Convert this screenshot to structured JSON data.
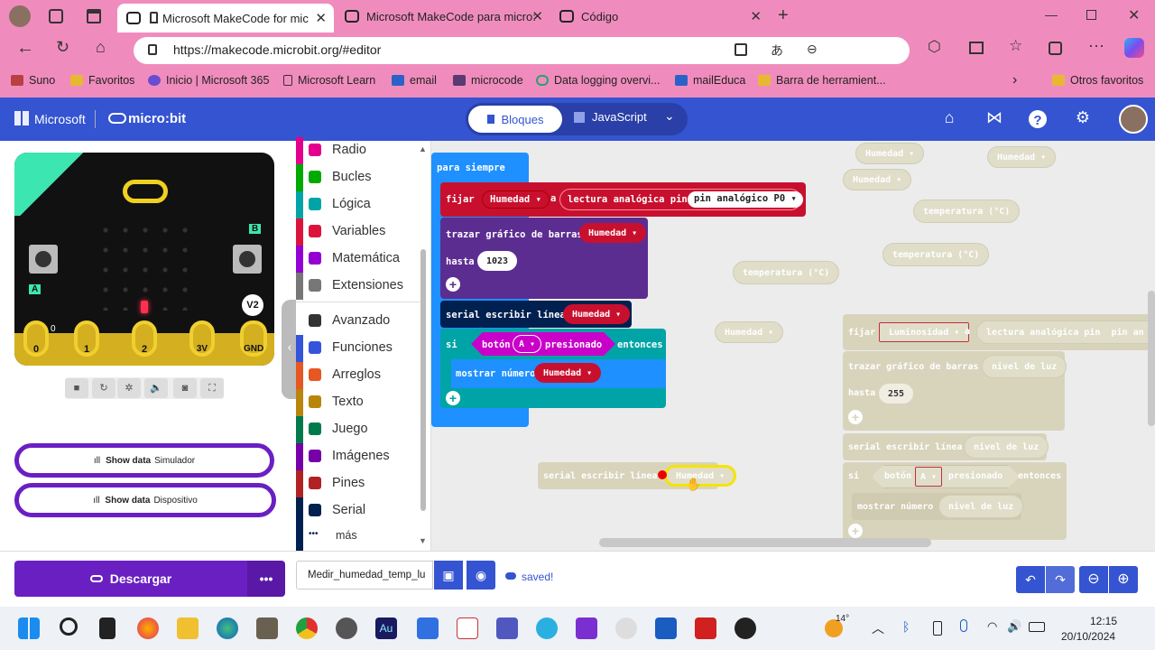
{
  "browser": {
    "tabs": [
      {
        "label": "Microsoft MakeCode for mic",
        "active": true
      },
      {
        "label": "Microsoft MakeCode para micro:",
        "active": false
      },
      {
        "label": "Código",
        "active": false
      }
    ],
    "url": "https://makecode.microbit.org/#editor",
    "bookmarks": [
      "Suno",
      "Favoritos",
      "Inicio | Microsoft 365",
      "Microsoft Learn",
      "email",
      "microcode",
      "Data logging overvi...",
      "mailEduca",
      "Barra de herramient..."
    ],
    "other_favorites": "Otros favoritos"
  },
  "header": {
    "brand": "Microsoft",
    "product": "micro:bit",
    "blocks_tab": "Bloques",
    "js_tab": "JavaScript",
    "accent": "#3454d1"
  },
  "simulator": {
    "pins": [
      "0",
      "1",
      "2",
      "3V",
      "GND"
    ],
    "pin_small": "0",
    "badge": "V2",
    "btn_a": "A",
    "btn_b": "B",
    "show_data_sim": {
      "bold": "Show data",
      "rest": "Simulador"
    },
    "show_data_dev": {
      "bold": "Show data",
      "rest": "Dispositivo"
    }
  },
  "toolbox": {
    "categories": [
      {
        "label": "Radio",
        "color": "#e3008c"
      },
      {
        "label": "Bucles",
        "color": "#00aa00"
      },
      {
        "label": "Lógica",
        "color": "#00a4a6"
      },
      {
        "label": "Variables",
        "color": "#dc143c"
      },
      {
        "label": "Matemática",
        "color": "#9400d3"
      },
      {
        "label": "Extensiones",
        "color": "#777777"
      },
      {
        "label": "Avanzado",
        "color": "#333333"
      },
      {
        "label": "Funciones",
        "color": "#3455db"
      },
      {
        "label": "Arreglos",
        "color": "#e65722"
      },
      {
        "label": "Texto",
        "color": "#b8860b"
      },
      {
        "label": "Juego",
        "color": "#007a4b"
      },
      {
        "label": "Imágenes",
        "color": "#7600a8"
      },
      {
        "label": "Pines",
        "color": "#b22222"
      },
      {
        "label": "Serial",
        "color": "#002050"
      },
      {
        "label": "más",
        "color": "#002050"
      }
    ]
  },
  "workspace": {
    "forever": "para siempre",
    "set_block": {
      "set": "fijar",
      "var": "Humedad",
      "to": "a",
      "reader": "lectura analógica pin",
      "pin": "pin analógico P0"
    },
    "plot_block": {
      "label": "trazar gráfico de barras",
      "var": "Humedad",
      "upto": "hasta",
      "value": "1023"
    },
    "serial_block": {
      "label": "serial escribir línea",
      "var": "Humedad"
    },
    "if_block": {
      "if": "si",
      "button": "botón",
      "btn": "A",
      "pressed": "presionado",
      "then": "entonces"
    },
    "show_block": {
      "label": "mostrar número",
      "var": "Humedad"
    },
    "loose_serial": {
      "label": "serial escribir línea",
      "var": "Humedad"
    },
    "ghosts": {
      "humedad": "Humedad",
      "temperatura": "temperatura (°C)",
      "set_label": "fijar",
      "luminosidad": "Luminosidad",
      "to": "a",
      "reader": "lectura analógica pin",
      "pin_cut": "pin an",
      "plot": "trazar gráfico de barras",
      "light": "nivel de luz",
      "upto": "hasta",
      "value": "255",
      "serial": "serial escribir línea",
      "if": "si",
      "button": "botón",
      "btn": "A",
      "pressed": "presionado",
      "then": "entonces",
      "show": "mostrar número"
    }
  },
  "footer": {
    "download": "Descargar",
    "project_name": "Medir_humedad_temp_lu",
    "status": "saved!",
    "more": "•••"
  },
  "taskbar": {
    "weather": "14°",
    "time": "12:15",
    "date": "20/10/2024"
  }
}
